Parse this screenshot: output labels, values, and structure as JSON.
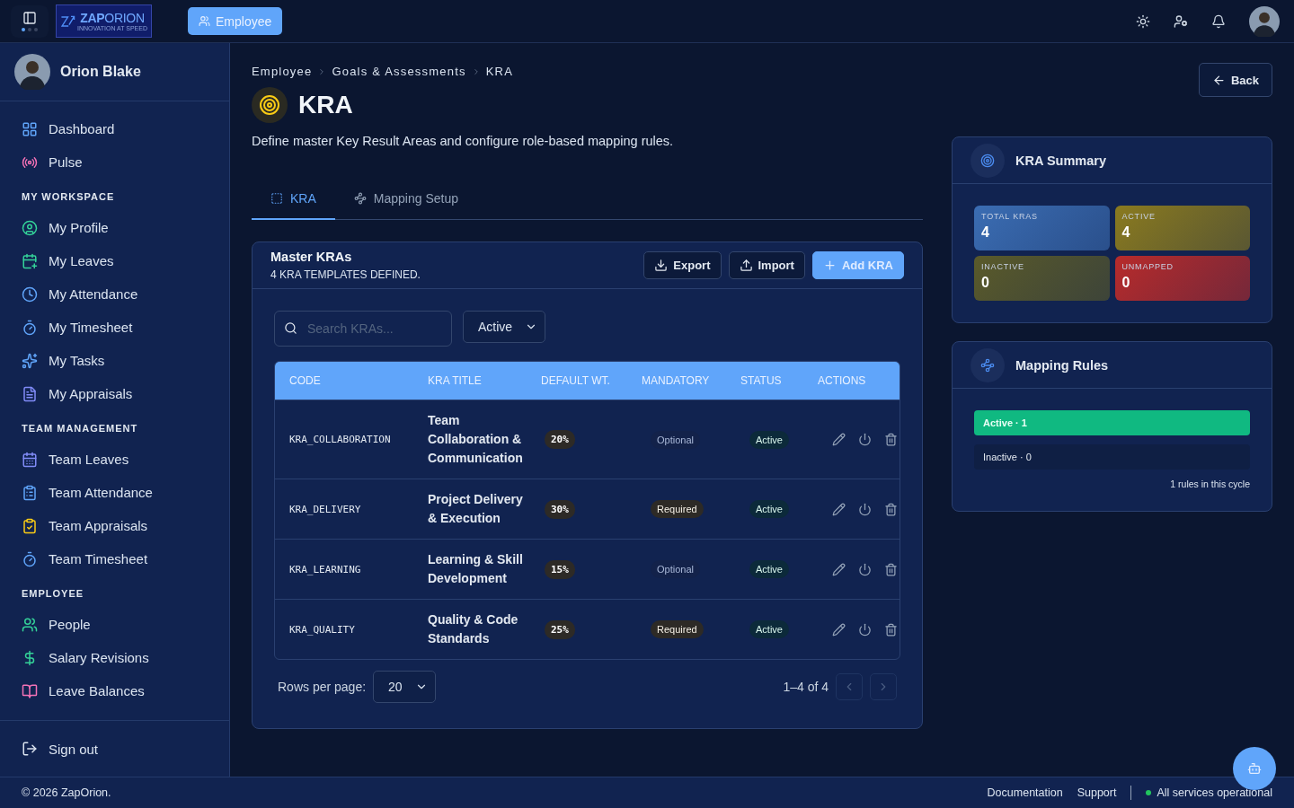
{
  "topbar": {
    "brand": {
      "name": "**ZAP**ORION",
      "tagline": "INNOVATION AT SPEED"
    },
    "module_button": "Employee"
  },
  "sidebar": {
    "user": "Orion Blake",
    "sections": [
      {
        "items": [
          {
            "label": "Dashboard",
            "selected": false
          },
          {
            "label": "Pulse",
            "selected": false
          }
        ]
      },
      {
        "title": "MY WORKSPACE",
        "items": [
          {
            "label": "My Profile",
            "selected": false
          },
          {
            "label": "My Leaves",
            "selected": false
          },
          {
            "label": "My Attendance",
            "selected": false
          },
          {
            "label": "My Timesheet",
            "selected": false
          },
          {
            "label": "My Tasks",
            "selected": false
          },
          {
            "label": "My Appraisals",
            "selected": false
          }
        ]
      },
      {
        "title": "TEAM MANAGEMENT",
        "items": [
          {
            "label": "Team Leaves",
            "selected": false
          },
          {
            "label": "Team Attendance",
            "selected": false
          },
          {
            "label": "Team Appraisals",
            "selected": false
          },
          {
            "label": "Team Timesheet",
            "selected": false
          }
        ]
      },
      {
        "title": "EMPLOYEE",
        "items": [
          {
            "label": "People",
            "selected": false
          },
          {
            "label": "Salary Revisions",
            "selected": false
          },
          {
            "label": "Leave Balances",
            "selected": false
          }
        ]
      }
    ],
    "sign_out": "Sign out"
  },
  "breadcrumb": [
    "Employee",
    "Goals & Assessments",
    "KRA"
  ],
  "page": {
    "title": "KRA",
    "subtitle": "Define master Key Result Areas and configure role-based mapping rules.",
    "back": "Back"
  },
  "tabs": [
    {
      "label": "KRA",
      "selected": true
    },
    {
      "label": "Mapping Setup",
      "selected": false
    }
  ],
  "master": {
    "title": "Master KRAs",
    "subtitle": "4 KRA TEMPLATES DEFINED.",
    "buttons": [
      {
        "label": "Export",
        "kind": "export"
      },
      {
        "label": "Import",
        "kind": "import"
      },
      {
        "label": "Add KRA",
        "kind": "add"
      }
    ],
    "search": {
      "placeholder": "Search KRAs..."
    },
    "filter": "Active",
    "columns": [
      "CODE",
      "KRA TITLE",
      "DEFAULT WT.",
      "MANDATORY",
      "STATUS",
      "ACTIONS"
    ],
    "rows": [
      {
        "code": "KRA_COLLABORATION",
        "title": "Team Collaboration & Communication",
        "weight": "20%",
        "mandatory": "Optional",
        "required": false,
        "status": "Active"
      },
      {
        "code": "KRA_DELIVERY",
        "title": "Project Delivery & Execution",
        "weight": "30%",
        "mandatory": "Required",
        "required": true,
        "status": "Active"
      },
      {
        "code": "KRA_LEARNING",
        "title": "Learning & Skill Development",
        "weight": "15%",
        "mandatory": "Optional",
        "required": false,
        "status": "Active"
      },
      {
        "code": "KRA_QUALITY",
        "title": "Quality & Code Standards",
        "weight": "25%",
        "mandatory": "Required",
        "required": true,
        "status": "Active"
      }
    ],
    "rows_per_page_label": "Rows per page:",
    "rows_per_page": "20",
    "range": "1–4 of 4"
  },
  "summary": {
    "title": "KRA Summary",
    "stats": [
      {
        "label": "TOTAL KRAS",
        "value": "4",
        "color": "#3b6db3"
      },
      {
        "label": "ACTIVE",
        "value": "4",
        "color": "#8a7a1f"
      },
      {
        "label": "INACTIVE",
        "value": "0",
        "color": "#5a5a2a"
      },
      {
        "label": "UNMAPPED",
        "value": "0",
        "color": "#b72b2b"
      }
    ]
  },
  "mapping": {
    "title": "Mapping Rules",
    "bars": [
      {
        "label": "Active · 1",
        "on": true
      },
      {
        "label": "Inactive · 0",
        "on": false
      }
    ],
    "note": "1 rules in this cycle"
  },
  "footer": {
    "copyright": "© 2026 ZapOrion.",
    "links": [
      "Documentation",
      "Support"
    ],
    "status": "All services operational"
  }
}
